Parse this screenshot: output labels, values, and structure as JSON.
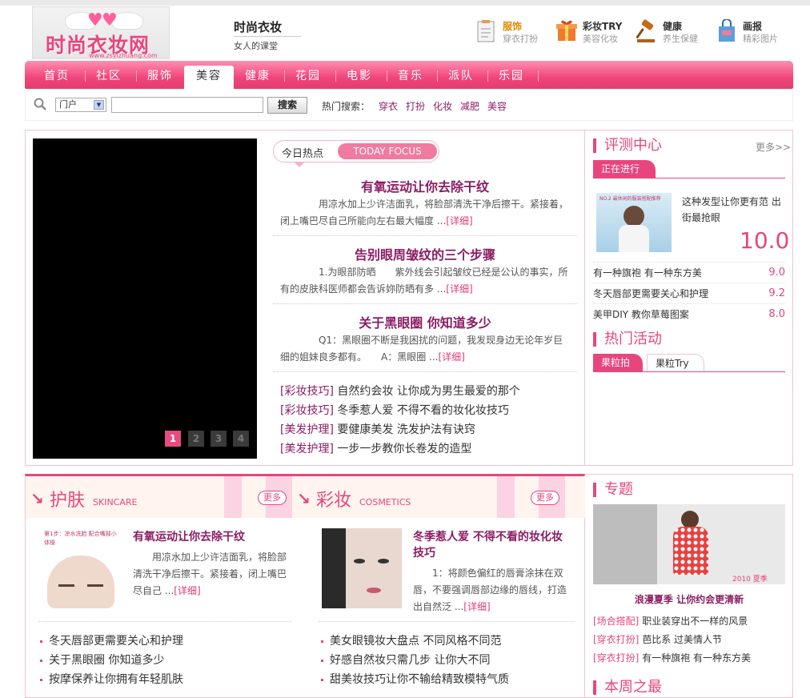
{
  "header": {
    "logo_text": "时尚衣妆网",
    "logo_url": "www.zsyizhuang.com",
    "site_title": "时尚衣妆",
    "site_subtitle": "女人的课堂",
    "channels": [
      {
        "title": "服饰",
        "sub": "穿衣打扮",
        "icon": "clipboard-icon"
      },
      {
        "title": "彩妆TRY",
        "sub": "美容化妆",
        "icon": "gift-box-icon"
      },
      {
        "title": "健康",
        "sub": "养生保健",
        "icon": "gavel-icon"
      },
      {
        "title": "画报",
        "sub": "精彩图片",
        "icon": "shopping-bag-icon"
      }
    ]
  },
  "nav": {
    "items": [
      "首页",
      "社区",
      "服饰",
      "美容",
      "健康",
      "花园",
      "电影",
      "音乐",
      "派队",
      "乐园"
    ],
    "active": "美容"
  },
  "search": {
    "scope": "门户",
    "query": "",
    "button": "搜索",
    "hot_label": "热门搜索：",
    "hot_terms": [
      "穿衣",
      "打扮",
      "化妆",
      "减肥",
      "美容"
    ]
  },
  "slider": {
    "pages": [
      "1",
      "2",
      "3",
      "4"
    ],
    "current": "1"
  },
  "focus": {
    "label_cn": "今日热点",
    "label_en": "TODAY FOCUS",
    "articles": [
      {
        "title": "有氧运动让你去除干纹",
        "body": "用凉水加上少许洁面乳，将脸部清洗干净后擦干。紧接着，闭上嘴巴尽自己所能向左右最大幅度 ...",
        "more": "[详细]"
      },
      {
        "title": "告别眼周皱纹的三个步骤",
        "body": "1.为眼部防晒　　紫外线会引起皱纹已经是公认的事实，所有的皮肤科医师都会告诉妳防晒有多 ...",
        "more": "[详细]"
      },
      {
        "title": "关于黑眼圈 你知道多少",
        "body": "Q1：黑眼圈不断是我困扰的问题，我发现身边无论年岁巨细的姐妹良多都有。　　A：黑眼圈 ...",
        "more": "[详细]"
      }
    ],
    "tips": [
      {
        "tag": "[彩妆技巧]",
        "text": "自然约会妆 让你成为男生最爱的那个"
      },
      {
        "tag": "[彩妆技巧]",
        "text": "冬季惹人爱 不得不看的妆化妆技巧"
      },
      {
        "tag": "[美发护理]",
        "text": "要健康美发 洗发护法有诀窍"
      },
      {
        "tag": "[美发护理]",
        "text": "一步一步教你长卷发的造型"
      }
    ]
  },
  "review": {
    "title": "评测中心",
    "more": "更多>>",
    "tab": "正在进行",
    "feature": {
      "image_caption": "NO.2 最休闲的服装搭配推荐",
      "desc": "这种发型让你更有范 出街最抢眼",
      "score": "10.0"
    },
    "rows": [
      {
        "text": "有一种旗袍 有一种东方美",
        "score": "9.0"
      },
      {
        "text": "冬天唇部更需要关心和护理",
        "score": "9.2"
      },
      {
        "text": "美甲DIY 教你草莓图案",
        "score": "8.0"
      }
    ]
  },
  "activity": {
    "title": "热门活动",
    "tabs": [
      "果粒拍",
      "果粒Try"
    ]
  },
  "skincare": {
    "cn": "护肤",
    "en": "SKINCARE",
    "more": "更多",
    "image_text": "第1步：凉水洗脸 配合嘴部小体操",
    "title": "有氧运动让你去除干纹",
    "body": "用凉水加上少许洁面乳，将脸部清洗干净后擦干。紧接着，闭上嘴巴尽自己 ...",
    "detail": "[详细]",
    "list": [
      "冬天唇部更需要关心和护理",
      "关于黑眼圈 你知道多少",
      "按摩保养让你拥有年轻肌肤"
    ]
  },
  "cosmetics": {
    "cn": "彩妆",
    "en": "COSMETICS",
    "more": "更多",
    "title": "冬季惹人爱 不得不看的妆化妆技巧",
    "body": "1：将颜色偏红的唇膏涂抹在双唇，不要强调唇部边缘的唇线，打造出自然泛 ...",
    "detail": "[详细]",
    "list": [
      "美女眼镜妆大盘点 不同风格不同范",
      "好感自然妆只需几步 让你大不同",
      "甜美妆技巧让你不输给精致模特气质"
    ]
  },
  "topic": {
    "title": "专题",
    "image_text": "2010 夏季",
    "caption": "浪漫夏季 让你约会更清新",
    "rows": [
      {
        "tag": "[场合搭配]",
        "text": "职业装穿出不一样的风景"
      },
      {
        "tag": "[穿衣打扮]",
        "text": "芭比系 过美情人节"
      },
      {
        "tag": "[穿衣打扮]",
        "text": "有一种旗袍 有一种东方美"
      }
    ],
    "next_title": "本周之最"
  },
  "colors": {
    "accent": "#e8457e",
    "title": "#8b1d63",
    "nav_top": "#ff8fb0"
  }
}
